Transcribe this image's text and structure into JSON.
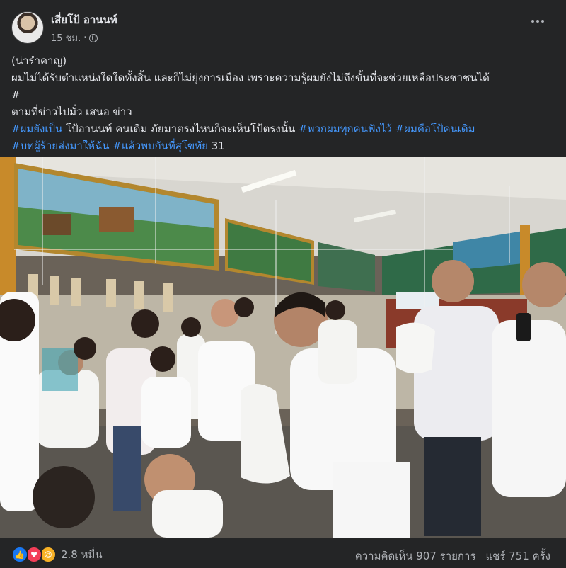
{
  "post": {
    "author": "เสี่ยโป้ อานนท์",
    "time": "15 ชม.",
    "dot": "·",
    "lines": [
      "(น่ารำคาญ)",
      "ผมไม่ได้รับตำแหน่งใดใดทั้งสิ้น และก็ไม่ยุ่งการเมือง เพราะความรู้ผมยังไม่ถึงขั้นที่จะช่วยเหลือประชาชนได้",
      "#",
      "ตามที่ข่าวไปมั่ว เสนอ ข่าว"
    ],
    "line5": {
      "tag1": "#ผมยังเป็น",
      "text": " โป้อานนท์ คนเดิม ภัยมาตรงไหนก็จะเห็นโป้ตรงนั้น ",
      "tag2": "#พวกผมทุกคนฟังไว้",
      "space": " ",
      "tag3": "#ผมคือโป้คนเดิม"
    },
    "line6": {
      "tag1": "#บทผู้ร้ายส่งมาให้ฉัน",
      "space": " ",
      "tag2": "#แล้วพบกันที่สุโขทัย",
      "text": " 31"
    }
  },
  "footer": {
    "reaction_count": "2.8 หมื่น",
    "comments": "ความคิดเห็น 907 รายการ",
    "shares": "แชร์ 751 ครั้ง"
  },
  "icons": {
    "like": "thumbs-up-icon",
    "love": "heart-icon",
    "haha": "laughing-face-icon",
    "privacy": "globe-icon",
    "menu": "more-horizontal-icon"
  },
  "colors": {
    "background": "#242526",
    "text": "#e4e6eb",
    "secondary": "#b0b3b8",
    "hashtag": "#4599ff",
    "like": "#1877f2",
    "love": "#f33e58",
    "haha": "#f7b125"
  }
}
